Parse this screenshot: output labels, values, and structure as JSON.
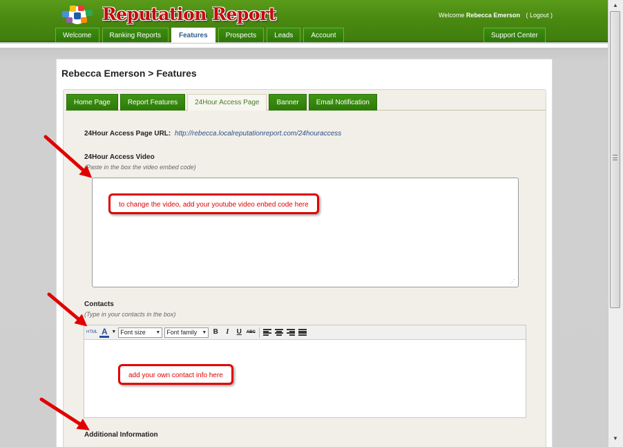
{
  "app": {
    "logo_text": "Reputation Report",
    "welcome_prefix": "Welcome",
    "user_name": "Rebecca Emerson",
    "logout": "( Logout )"
  },
  "nav": {
    "tabs": [
      {
        "label": "Welcome"
      },
      {
        "label": "Ranking Reports"
      },
      {
        "label": "Features",
        "active": true
      },
      {
        "label": "Prospects"
      },
      {
        "label": "Leads"
      },
      {
        "label": "Account"
      }
    ],
    "support": "Support Center"
  },
  "page": {
    "title": "Rebecca Emerson > Features"
  },
  "subtabs": [
    {
      "label": "Home Page"
    },
    {
      "label": "Report Features"
    },
    {
      "label": "24Hour Access Page",
      "active": true
    },
    {
      "label": "Banner"
    },
    {
      "label": "Email Notification"
    }
  ],
  "form": {
    "url_label": "24Hour Access Page URL:",
    "url_value": "http://rebecca.localreputationreport.com/24houraccess",
    "video_label": "24Hour Access Video",
    "video_hint": "(Paste in the box the video embed code)",
    "contacts_label": "Contacts",
    "contacts_hint": "(Type in your contacts in the box)",
    "additional_label": "Additional Information"
  },
  "editor": {
    "html_btn": "HTML",
    "font_color_btn": "A",
    "font_size": "Font size",
    "font_family": "Font family",
    "bold": "B",
    "italic": "I",
    "underline": "U",
    "strike": "ABC"
  },
  "callouts": {
    "video": "to change the video, add your youtube video enbed code here",
    "contacts": "add your own contact info here"
  },
  "colors": {
    "header_green": "#4a8a12",
    "callout_red": "#e00000",
    "tab_green": "#2d7a08"
  }
}
